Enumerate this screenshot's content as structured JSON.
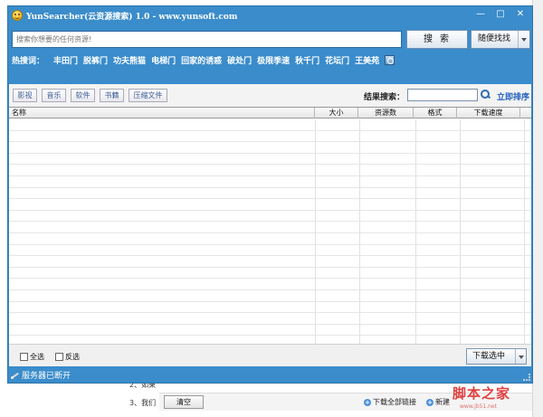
{
  "window": {
    "title": "YunSearcher(云资源搜索) 1.0 - www.yunsoft.com",
    "min_glyph": "—",
    "max_glyph": "□",
    "close_glyph": "✕"
  },
  "search": {
    "placeholder": "搜索你想要的任何资源!",
    "button_label": "搜索",
    "random_label": "随便找找"
  },
  "hotwords": {
    "label": "热搜词：",
    "items": [
      "丰田门",
      "脱裤门",
      "功夫熊猫",
      "电梯门",
      "回家的诱惑",
      "破处门",
      "极限季速",
      "秋千门",
      "花坛门",
      "王美苑"
    ]
  },
  "categories": [
    "影视",
    "音乐",
    "软件",
    "书籍",
    "压缩文件"
  ],
  "result_search": {
    "label": "结果搜索：",
    "sort_label": "立即排序"
  },
  "table": {
    "columns": [
      "名称",
      "大小",
      "资源数",
      "格式",
      "下载速度"
    ],
    "rows": []
  },
  "bottom": {
    "select_all": "全选",
    "invert": "反选",
    "download_selected": "下载选中"
  },
  "status": {
    "text": "服务器已断开"
  },
  "background": {
    "steps": [
      "2、如果",
      "3、我们"
    ],
    "clear_label": "清空",
    "download_all_label": "下载全部链接",
    "new_label": "新建",
    "watermark": "脚本之家",
    "watermark_url": "www.jb51.net"
  }
}
